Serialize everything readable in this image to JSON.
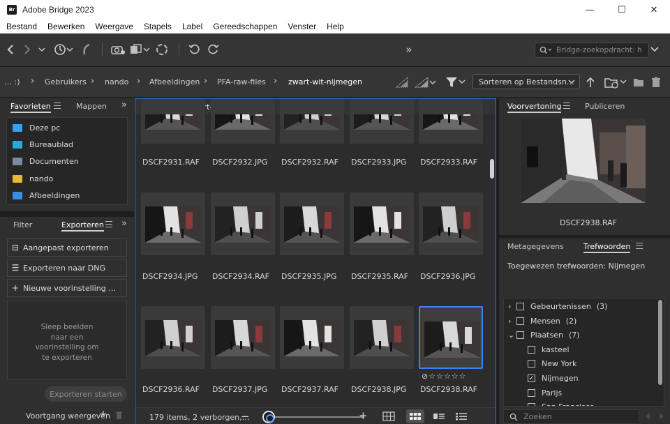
{
  "window": {
    "title": "Adobe Bridge 2023",
    "logo_text": "Br",
    "minimize": "—",
    "maximize": "☐",
    "close": "✕"
  },
  "menu": [
    "Bestand",
    "Bewerken",
    "Weergave",
    "Stapels",
    "Label",
    "Gereedschappen",
    "Venster",
    "Help"
  ],
  "toolbar": {
    "search_placeholder": "Bridge-zoekopdracht: h",
    "more": "»"
  },
  "breadcrumb": {
    "root": "… :)",
    "items": [
      "Gebruikers",
      "nando",
      "Afbeeldingen",
      "PFA-raw-files",
      "zwart-wit-nijmegen"
    ]
  },
  "sort": {
    "label": "Sorteren op Bestandsn…"
  },
  "left_top_panel": {
    "tabs": [
      "Favorieten",
      "Mappen"
    ],
    "items": [
      {
        "label": "Deze pc",
        "color": "#3aa0e8"
      },
      {
        "label": "Bureaublad",
        "color": "#29a8d8"
      },
      {
        "label": "Documenten",
        "color": "#7a8aa0"
      },
      {
        "label": "nando",
        "color": "#e8b73a"
      },
      {
        "label": "Afbeeldingen",
        "color": "#3a8ee0"
      }
    ]
  },
  "left_bottom_panel": {
    "tabs": [
      "Filter",
      "Exporteren"
    ],
    "items": [
      {
        "icon": "⊟",
        "label": "Aangepast exporteren"
      },
      {
        "icon": "☰",
        "label": "Exporteren naar DNG"
      },
      {
        "icon": "+",
        "label": "Nieuwe voorinstelling …"
      }
    ],
    "drop_text": [
      "Sleep beelden",
      "naar een",
      "voorinstelling om",
      "te exporteren"
    ],
    "start_button": "Exporteren starten",
    "progress_label": "Voortgang weergeven"
  },
  "content": {
    "header": "Inhoud: zwart-wit-nijmegen",
    "rows": [
      [
        "DSCF2931.RAF",
        "DSCF2932.JPG",
        "DSCF2932.RAF",
        "DSCF2933.JPG",
        "DSCF2933.RAF"
      ],
      [
        "DSCF2934.JPG",
        "DSCF2934.RAF",
        "DSCF2935.JPG",
        "DSCF2935.RAF",
        "DSCF2936.JPG"
      ],
      [
        "DSCF2936.RAF",
        "DSCF2937.JPG",
        "DSCF2937.RAF",
        "DSCF2938.JPG",
        "DSCF2938.RAF"
      ]
    ],
    "rating": "⊘☆☆☆☆☆",
    "status": "179 items, 2 verborgen,…"
  },
  "preview_panel": {
    "tabs": [
      "Voorvertoning",
      "Publiceren"
    ],
    "filename": "DSCF2938.RAF"
  },
  "keywords_panel": {
    "tabs": [
      "Metagegevens",
      "Trefwoorden"
    ],
    "assigned": "Toegewezen trefwoorden: Nijmegen",
    "items": [
      {
        "arrow": "›",
        "label": "Gebeurtenissen",
        "count": "(3)",
        "checked": ""
      },
      {
        "arrow": "›",
        "label": "Mensen",
        "count": "(2)",
        "checked": ""
      },
      {
        "arrow": "⌄",
        "label": "Plaatsen",
        "count": "(7)",
        "checked": ""
      },
      {
        "arrow": "",
        "label": "kasteel",
        "count": "",
        "checked": ""
      },
      {
        "arrow": "",
        "label": "New York",
        "count": "",
        "checked": ""
      },
      {
        "arrow": "",
        "label": "Nijmegen",
        "count": "",
        "checked": "✓"
      },
      {
        "arrow": "",
        "label": "Parijs",
        "count": "",
        "checked": ""
      },
      {
        "arrow": "",
        "label": "San Francisco",
        "count": "",
        "checked": ""
      }
    ],
    "search_placeholder": "Zoeken"
  }
}
